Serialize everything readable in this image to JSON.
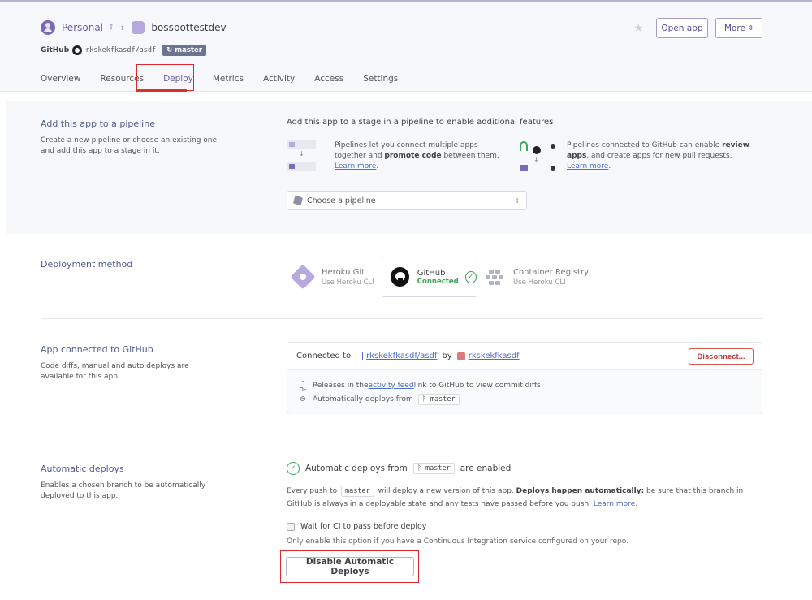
{
  "header": {
    "account": "Personal",
    "app_name": "bossbottestdev",
    "github_label": "GitHub",
    "repo": "rkskekfkasdf/asdf",
    "branch_badge": "master",
    "open_app": "Open app",
    "more": "More"
  },
  "tabs": [
    "Overview",
    "Resources",
    "Deploy",
    "Metrics",
    "Activity",
    "Access",
    "Settings"
  ],
  "pipeline": {
    "title": "Add this app to a pipeline",
    "desc": "Create a new pipeline or choose an existing one and add this app to a stage in it.",
    "right_title": "Add this app to a stage in a pipeline to enable additional features",
    "feature1_a": "Pipelines let you connect multiple apps together and ",
    "feature1_b": "promote code",
    "feature1_c": " between them.",
    "feature2_a": "Pipelines connected to GitHub can enable ",
    "feature2_b": "review apps",
    "feature2_c": ", and create apps for new pull requests.",
    "learn_more": "Learn more",
    "select_placeholder": "Choose a pipeline"
  },
  "deployment": {
    "title": "Deployment method",
    "heroku_git": "Heroku Git",
    "heroku_git_sub": "Use Heroku CLI",
    "github": "GitHub",
    "github_status": "Connected",
    "container": "Container Registry",
    "container_sub": "Use Heroku CLI"
  },
  "connected": {
    "title": "App connected to GitHub",
    "desc": "Code diffs, manual and auto deploys are available for this app.",
    "connected_to": "Connected to",
    "repo": "rkskekfkasdf/asdf",
    "by": "by",
    "user": "rkskekfkasdf",
    "disconnect": "Disconnect...",
    "releases_a": "Releases in the ",
    "activity_feed": "activity feed",
    "releases_b": " link to GitHub to view commit diffs",
    "auto_from": "Automatically deploys from",
    "branch": "master"
  },
  "auto": {
    "title": "Automatic deploys",
    "desc": "Enables a chosen branch to be automatically deployed to this app.",
    "line_a": "Automatic deploys from",
    "branch": "master",
    "line_b": "are enabled",
    "para_a": "Every push to",
    "para_b": "will deploy a new version of this app.",
    "para_bold": "Deploys happen automatically:",
    "para_c": "be sure that this branch in GitHub is always in a deployable state and any tests have passed before you push.",
    "learn_more": "Learn more.",
    "ci_label": "Wait for CI to pass before deploy",
    "ci_note": "Only enable this option if you have a Continuous Integration service configured on your repo.",
    "disable_btn": "Disable Automatic Deploys"
  }
}
